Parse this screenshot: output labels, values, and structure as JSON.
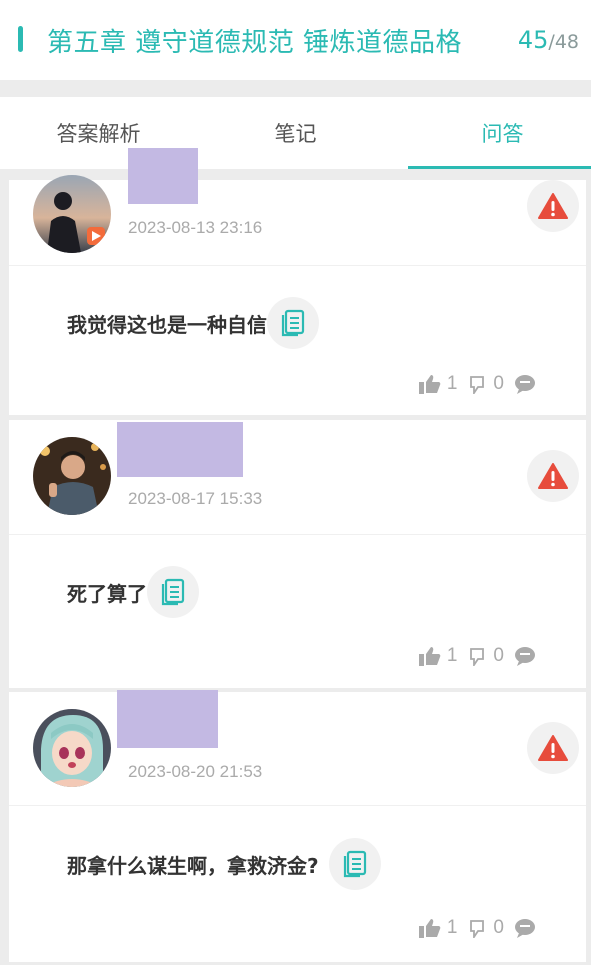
{
  "header": {
    "title": "第五章 遵守道德规范 锤炼道德品格",
    "current_page": "45",
    "separator": "/",
    "total_pages": "48"
  },
  "tabs": [
    {
      "label": "答案解析",
      "active": false
    },
    {
      "label": "笔记",
      "active": false
    },
    {
      "label": "问答",
      "active": true
    }
  ],
  "colors": {
    "accent": "#2bbab3",
    "warning": "#e74c3c",
    "name_redaction": "#c3b9e3"
  },
  "posts": [
    {
      "time": "2023-08-13 23:16",
      "answer": "我觉得这也是一种自信",
      "likes": "1",
      "dislikes": "0",
      "comment_icon": "comment-icon"
    },
    {
      "time": "2023-08-17 15:33",
      "answer": "死了算了",
      "likes": "1",
      "dislikes": "0",
      "comment_icon": "comment-icon"
    },
    {
      "time": "2023-08-20 21:53",
      "answer": "那拿什么谋生啊，拿救济金?",
      "likes": "1",
      "dislikes": "0",
      "comment_icon": "comment-icon"
    }
  ]
}
